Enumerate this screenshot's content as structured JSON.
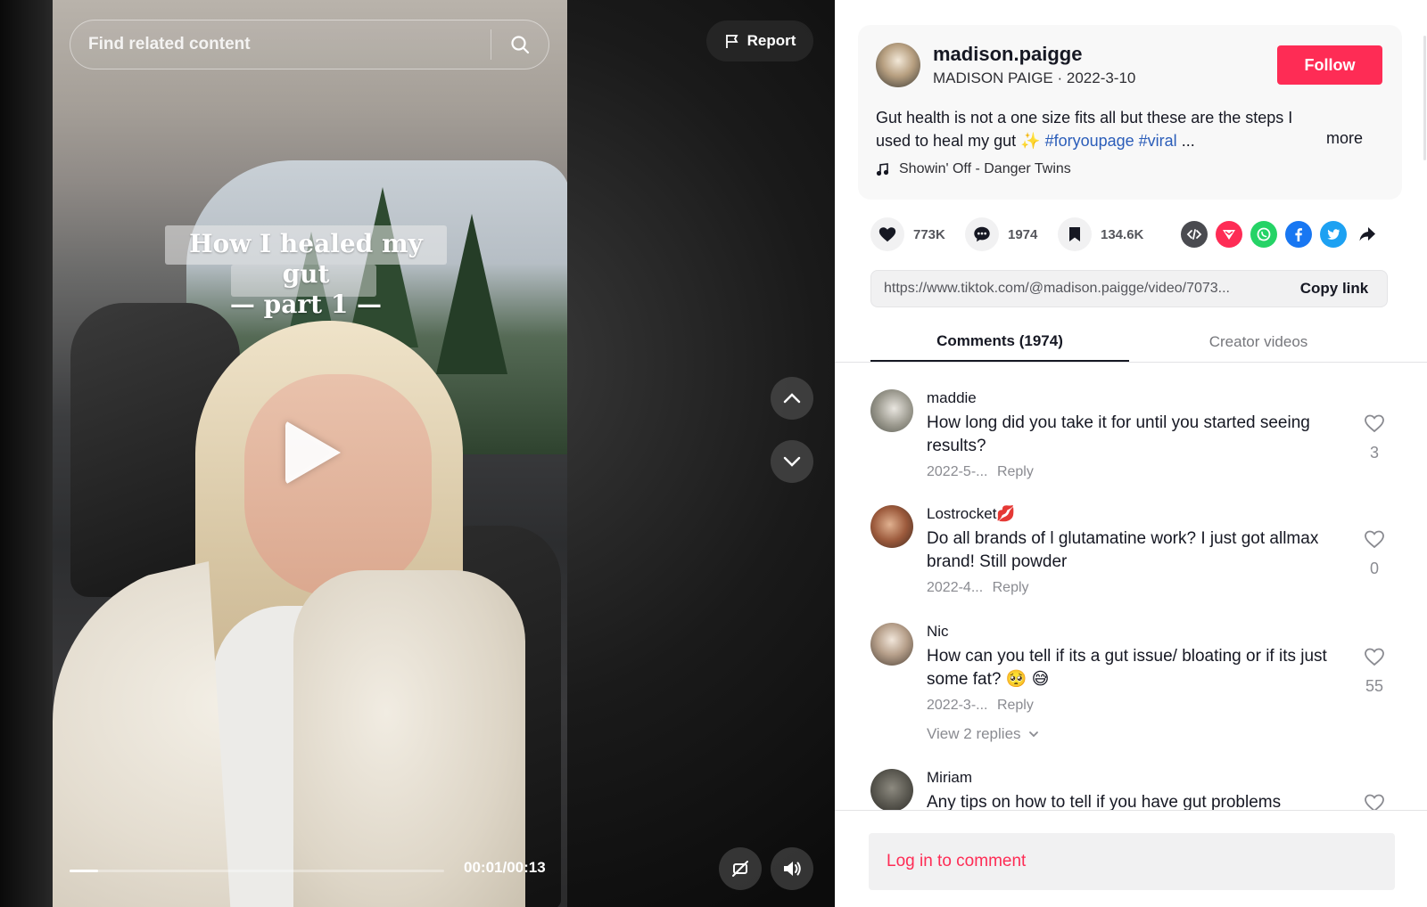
{
  "video": {
    "search_placeholder": "Find related content",
    "report_label": "Report",
    "caption_line1": "How I healed my gut",
    "caption_line2": "— part 1 —",
    "time": "00:01/00:13",
    "progress": 0.077
  },
  "author": {
    "username": "madison.paigge",
    "display_name": "MADISON PAIGE",
    "date": "2022-3-10",
    "subline": "MADISON PAIGE · 2022-3-10",
    "follow_label": "Follow",
    "description_line1": "Gut health is not a one size fits all but these are the steps I",
    "description_line2": "used to heal my gut",
    "description_emoji": "✨",
    "hashtag1": "#foryoupage",
    "hashtag2": "#viral",
    "ellipsis": "...",
    "more_label": "more",
    "music": "Showin' Off - Danger Twins"
  },
  "stats": {
    "likes": "773K",
    "comments": "1974",
    "saves": "134.6K"
  },
  "share": {
    "link": "https://www.tiktok.com/@madison.paigge/video/7073...",
    "copy_label": "Copy link"
  },
  "tabs": {
    "comments": "Comments (1974)",
    "creator_videos": "Creator videos"
  },
  "comments": [
    {
      "user": "maddie",
      "text": "How long did you take it for until you started seeing results?",
      "date": "2022-5-...",
      "reply": "Reply",
      "likes": "3"
    },
    {
      "user": "Lostrocket💋",
      "text": "Do all brands of l glutamatine work? I just got allmax brand! Still powder",
      "date": "2022-4...",
      "reply": "Reply",
      "likes": "0"
    },
    {
      "user": "Nic",
      "text": "How can you tell if its a gut issue/ bloating or if its just some fat? 🥺 😅",
      "date": "2022-3-...",
      "reply": "Reply",
      "likes": "55",
      "view_replies": "View 2 replies"
    },
    {
      "user": "Miriam",
      "text": "Any tips on how to tell if you have gut problems"
    }
  ],
  "login_prompt": "Log in to comment",
  "colors": {
    "accent": "#fe2c55",
    "hashtag": "#2b5db9",
    "whatsapp": "#25d366",
    "facebook": "#1877f2",
    "twitter": "#1da1f2",
    "embed": "#4a4b50"
  }
}
